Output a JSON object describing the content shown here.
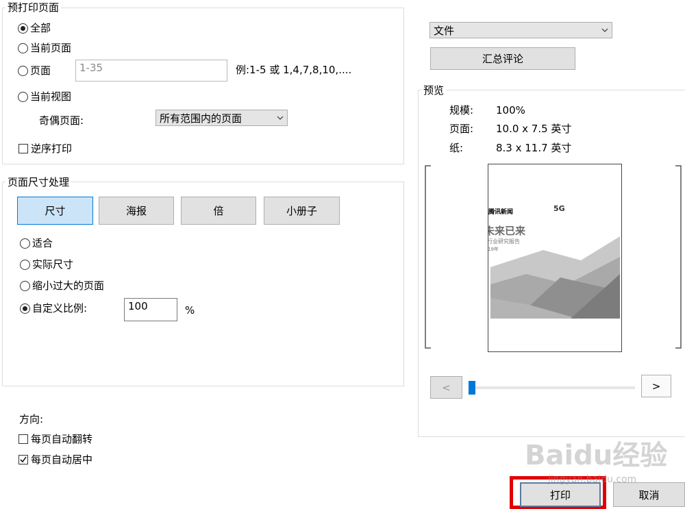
{
  "print_range": {
    "legend": "预打印页面",
    "all": "全部",
    "current_page": "当前页面",
    "pages": "页面",
    "pages_value": "1-35",
    "pages_hint": "例:1-5 或 1,4,7,8,10,....",
    "current_view": "当前视图",
    "odd_even_label": "奇偶页面:",
    "odd_even_value": "所有范围内的页面",
    "reverse": "逆序打印"
  },
  "page_sizing": {
    "legend": "页面尺寸处理",
    "tabs": [
      "尺寸",
      "海报",
      "倍",
      "小册子"
    ],
    "fit": "适合",
    "actual_size": "实际尺寸",
    "shrink": "缩小过大的页面",
    "custom_scale": "自定义比例:",
    "custom_value": "100",
    "percent": "%"
  },
  "orientation": {
    "label": "方向:",
    "auto_rotate": "每页自动翻转",
    "auto_center": "每页自动居中"
  },
  "right_panel": {
    "document_select": "文件",
    "summarize_comments": "汇总评论",
    "preview_legend": "预览",
    "scale_label": "规模:",
    "scale_value": "100%",
    "page_label": "页面:",
    "page_value": "10.0 x 7.5 英寸",
    "paper_label": "纸:",
    "paper_value": "8.3 x 11.7 英寸",
    "prev": "<",
    "next": ">",
    "slider_value": 0
  },
  "preview_doc": {
    "logo_text": "腾讯新闻",
    "headline": "未来已来",
    "subtitle": "行业研究报告",
    "year": "19年",
    "fiveg": "5G"
  },
  "footer": {
    "print": "打印",
    "cancel": "取消"
  },
  "watermark": {
    "brand": "Baidu经验",
    "url": "jingyan.baidu.com"
  },
  "colors": {
    "highlight_red": "#e00000",
    "accent_blue": "#0078d7"
  }
}
